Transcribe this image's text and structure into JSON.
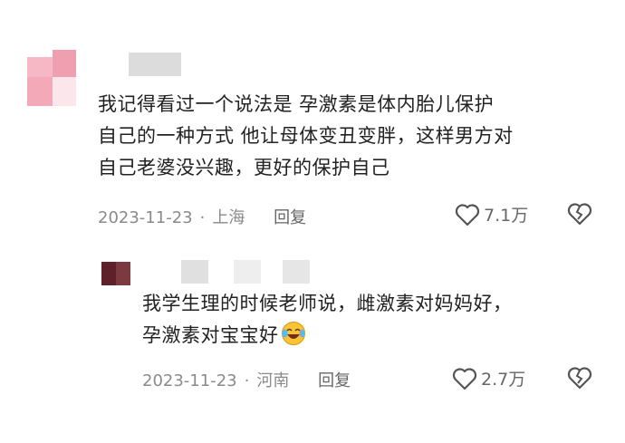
{
  "main_comment": {
    "lines": [
      "我记得看过一个说法是 孕激素是体内胎儿保护",
      "自己的一种方式 他让母体变丑变胖，这样男方对",
      "自己老婆没兴趣，更好的保护自己"
    ],
    "date": "2023-11-23",
    "location": "上海",
    "reply_label": "回复",
    "like_count": "7.1万"
  },
  "reply_comment": {
    "lines": [
      "我学生理的时候老师说，雌激素对妈妈好，",
      "孕激素对宝宝好"
    ],
    "emoji": "laughing-crying-emoji",
    "date": "2023-11-23",
    "location": "河南",
    "reply_label": "回复",
    "like_count": "2.7万"
  },
  "icons": {
    "like": "heart-outline-icon",
    "dislike": "broken-heart-icon"
  },
  "colors": {
    "text": "#222222",
    "meta": "#8a8a8a",
    "avatar_main": "#f0a5b4",
    "avatar_reply": "#6b2a30"
  }
}
